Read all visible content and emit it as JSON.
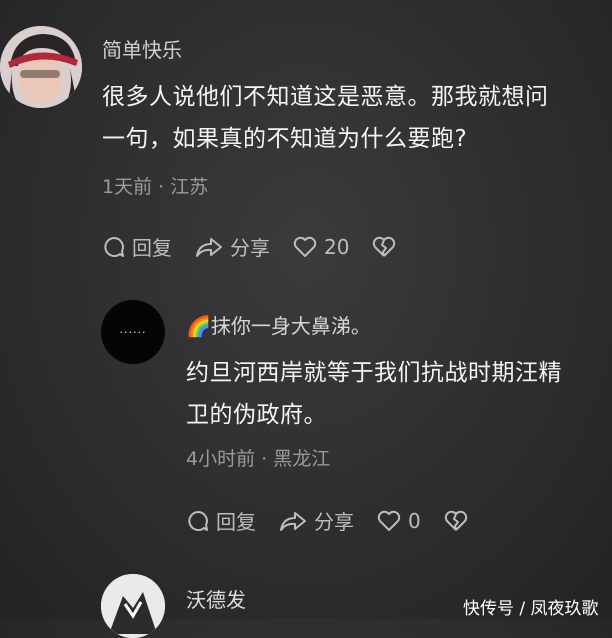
{
  "comment1": {
    "username": "简单快乐",
    "text_line1": "很多人说他们不知道这是恶意。那我就想问",
    "text_line2": "一句，如果真的不知道为什么要跑?",
    "meta": "1天前 · 江苏",
    "reply_label": "回复",
    "share_label": "分享",
    "like_count": "20"
  },
  "reply1": {
    "username_emoji": "🌈",
    "username": "抹你一身大鼻涕。",
    "avatar_text": "......",
    "text_line1": "约旦河西岸就等于我们抗战时期汪精",
    "text_line2": "卫的伪政府。",
    "meta": "4小时前 · 黑龙江",
    "reply_label": "回复",
    "share_label": "分享",
    "like_count": "0"
  },
  "comment2": {
    "username": "沃德发"
  },
  "watermark": "快传号 / 凤夜玖歌"
}
